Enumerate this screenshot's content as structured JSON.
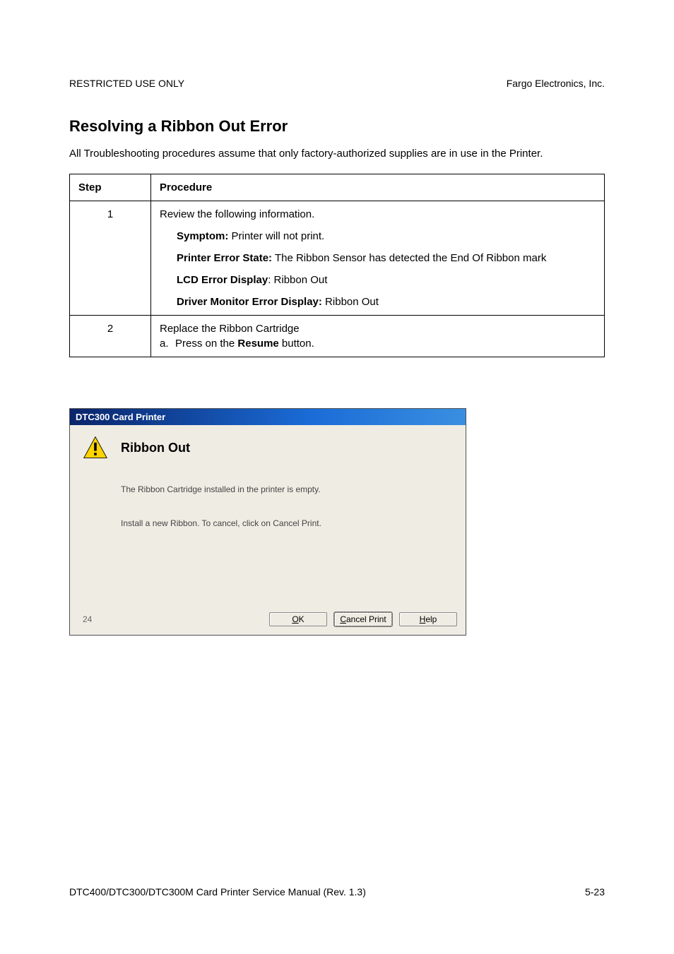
{
  "header": {
    "left": "RESTRICTED USE ONLY",
    "right": "Fargo Electronics, Inc."
  },
  "section": {
    "heading": "Resolving a Ribbon Out Error",
    "intro": "All Troubleshooting procedures assume that only factory-authorized supplies are in use in the Printer."
  },
  "table": {
    "col1": "Step",
    "col2": "Procedure",
    "rows": [
      {
        "step": "1",
        "lead": "Review the following information.",
        "symptom_label": "Symptom:",
        "symptom_text": " Printer will not print.",
        "state_label": "Printer Error State:",
        "state_text": " The Ribbon Sensor has detected the End Of Ribbon mark",
        "lcd_label": "LCD Error Display",
        "lcd_text": ": Ribbon Out",
        "driver_label": "Driver Monitor Error Display:",
        "driver_text": " Ribbon Out"
      },
      {
        "step": "2",
        "lead": "Replace the Ribbon Cartridge",
        "a_letter": "a.",
        "a_pre": "Press on the ",
        "a_strong": "Resume",
        "a_post": " button."
      }
    ]
  },
  "dialog": {
    "title": "DTC300 Card Printer",
    "heading": "Ribbon Out",
    "line1": "The Ribbon Cartridge installed in the printer is empty.",
    "line2": "Install a new Ribbon. To cancel, click on Cancel Print.",
    "count": "24",
    "buttons": {
      "ok_mn": "O",
      "ok_rest": "K",
      "cancel_mn": "C",
      "cancel_rest": "ancel Print",
      "help_mn": "H",
      "help_rest": "elp"
    }
  },
  "footer": {
    "left": "DTC400/DTC300/DTC300M Card Printer Service Manual (Rev. 1.3)",
    "right": "5-23"
  }
}
